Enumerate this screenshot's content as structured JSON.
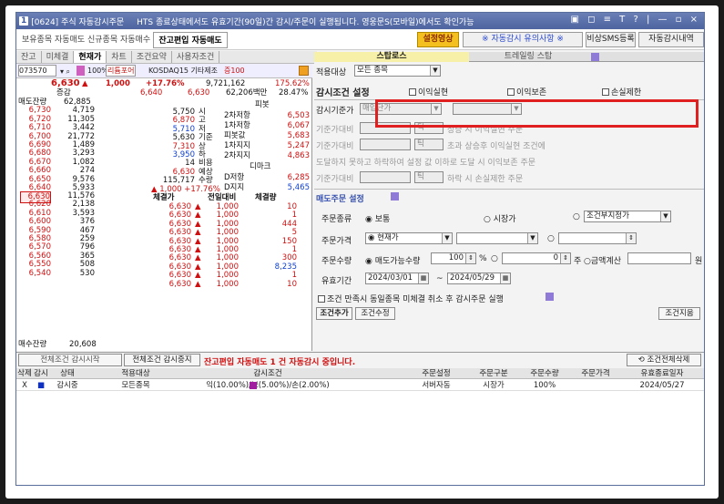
{
  "window": {
    "num": "1",
    "code": "[0624] 주식 자동감시주문",
    "notice": "HTS 종료상태에서도 유효기간(90일)간 감시/주문이 실행됩니다. 영웅문S(모바일)에서도 확인가능",
    "controls": "▣ ◻ ≡ T ? | — ▫ ×"
  },
  "tabs": {
    "t1": "보유종목 자동매도",
    "t2": "신규종목 자동매수",
    "t3": "잔고편입 자동매도",
    "b1": "설정영상",
    "b2": "※ 자동감시 유의사항 ※",
    "b3": "비상SMS등록",
    "b4": "자동감시내역"
  },
  "subtabs": [
    "잔고",
    "미체결",
    "현재가",
    "차트",
    "조건요약",
    "사용자조건"
  ],
  "codebar": {
    "code": "073570",
    "name": "리튬포어",
    "pct": "100%",
    "market": "KOSDAQ15 기타제조",
    "amt": "증100"
  },
  "quote": {
    "price": "6,630",
    "arrow": "▲",
    "chg": "1,000",
    "rate": "+17.76%",
    "vol": "9,721,162",
    "volrate": "175.62%",
    "prev_lbl": "증감",
    "prev1": "6,640",
    "prev2": "6,630",
    "amount": "62,206백만",
    "turn": "28.47%"
  },
  "ask_hdr": "매도잔량",
  "asks": [
    [
      "62,885",
      ""
    ],
    [
      "4,719",
      "6,730"
    ],
    [
      "11,305",
      "6,720"
    ],
    [
      "3,442",
      "6,710"
    ],
    [
      "21,772",
      "6,700"
    ],
    [
      "1,489",
      "6,690"
    ],
    [
      "3,293",
      "6,680"
    ],
    [
      "1,082",
      "6,670"
    ],
    [
      "274",
      "6,660"
    ],
    [
      "9,576",
      "6,650"
    ],
    [
      "5,933",
      "6,640"
    ]
  ],
  "bids": [
    [
      "6,630",
      "11,576"
    ],
    [
      "6,620",
      "2,138"
    ],
    [
      "6,610",
      "3,593"
    ],
    [
      "6,600",
      "376"
    ],
    [
      "6,590",
      "467"
    ],
    [
      "6,580",
      "259"
    ],
    [
      "6,570",
      "796"
    ],
    [
      "6,560",
      "365"
    ],
    [
      "6,550",
      "508"
    ],
    [
      "6,540",
      "530"
    ]
  ],
  "bid_total": {
    "label": "매수잔량",
    "v1": "20,608"
  },
  "info": [
    [
      "5,750",
      "시"
    ],
    [
      "6,870",
      "고"
    ],
    [
      "5,710",
      "저"
    ],
    [
      "5,630",
      "기준"
    ],
    [
      "7,310",
      "상"
    ],
    [
      "3,950",
      "하"
    ],
    [
      "14",
      "비용"
    ],
    [
      "6,630",
      "예상"
    ],
    [
      "115,717",
      "수량"
    ],
    [
      "▲ 1,000  +17.76%",
      ""
    ]
  ],
  "pivot": {
    "title": "피봇",
    "rows": [
      [
        "2차저항",
        "6,503"
      ],
      [
        "1차저항",
        "6,067"
      ],
      [
        "피봇값",
        "5,683"
      ],
      [
        "1차지지",
        "5,247"
      ],
      [
        "2차지지",
        "4,863"
      ]
    ],
    "dm": "디마크",
    "dm_rows": [
      [
        "D저항",
        "6,285"
      ],
      [
        "D지지",
        "5,465"
      ]
    ]
  },
  "trades_hdr": [
    "체결가",
    "전일대비",
    "체결량"
  ],
  "trades": [
    [
      "6,630",
      "1,000",
      "10"
    ],
    [
      "6,630",
      "1,000",
      "1"
    ],
    [
      "6,630",
      "1,000",
      "444"
    ],
    [
      "6,630",
      "1,000",
      "5"
    ],
    [
      "6,630",
      "1,000",
      "150"
    ],
    [
      "6,630",
      "1,000",
      "1"
    ],
    [
      "6,630",
      "1,000",
      "300"
    ],
    [
      "6,630",
      "1,000",
      "8,235"
    ],
    [
      "6,630",
      "1,000",
      "1"
    ],
    [
      "6,630",
      "1,000",
      "10"
    ]
  ],
  "right": {
    "tab1": "스탑로스",
    "tab2": "트레일링 스탑",
    "target_lbl": "적용대상",
    "target_val": "모든 종목",
    "cond_lbl": "감시조건 설정",
    "chk1": "이익실현",
    "chk2": "이익보존",
    "chk3": "손실제한",
    "base_lbl": "감시기준가",
    "base_val": "매입단가",
    "rows": [
      [
        "기준가대비",
        "틱",
        "상승 시 이익실현 주문"
      ],
      [
        "기준가대비",
        "틱",
        "초과 상승후 이익실현 조건에"
      ],
      [
        "도달하지 못하고 하락하여 설정 값 이하로 도달 시 이익보존 주문",
        "",
        ""
      ],
      [
        "기준가대비",
        "틱",
        "하락 시 손실제한 주문"
      ]
    ],
    "order_title": "매도주문 설정",
    "ord_type_lbl": "주문종류",
    "ord_type1": "보통",
    "ord_type2": "시장가",
    "ord_type3": "조건부지정가",
    "ord_price_lbl": "주문가격",
    "ord_price_val": "현재가",
    "ord_qty_lbl": "주문수량",
    "ord_qty_val": "매도가능수량",
    "ord_qty_pct": "100",
    "ord_qty_unit": "%",
    "ord_qty_zero": "0",
    "ord_qty_ju": "주",
    "ord_qty_amt": "금액계산",
    "ord_qty_won": "원",
    "valid_lbl": "유효기간",
    "valid_from": "2024/03/01",
    "valid_to": "2024/05/29",
    "cancel_lbl": "조건 만족시 동일종목 미체결 취소 후 감시주문 실행",
    "add": "조건추가",
    "edit": "조건수정",
    "clear": "조건지움"
  },
  "bottom": {
    "b1": "전체조건 감시시작",
    "b2": "전체조건 감시중지",
    "status": "잔고편입 자동매도 1 건 자동감시 중입니다.",
    "del": "조건전체삭제"
  },
  "grid": {
    "hdr": [
      "삭제",
      "감시",
      "상태",
      "적용대상",
      "감시조건",
      "주문설정",
      "주문구분",
      "주문수량",
      "주문가격",
      "유효종료일자"
    ],
    "row": [
      "X",
      "■",
      "감시중",
      "모든종목",
      "익(10.00%)/보(5.00%)/손(2.00%)",
      "서버자동",
      "시장가",
      "100%",
      "",
      "2024/05/27"
    ]
  }
}
